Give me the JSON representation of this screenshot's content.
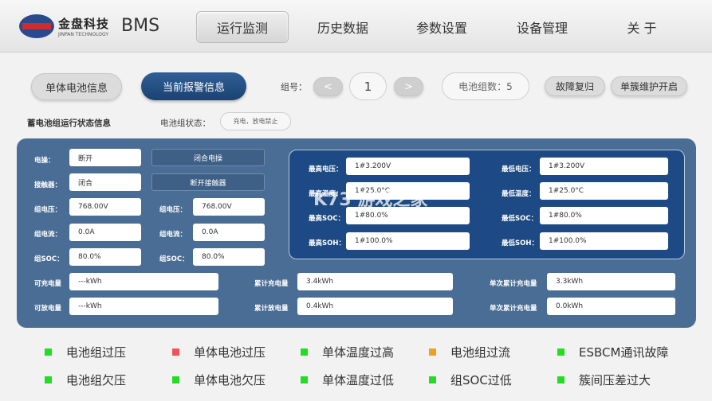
{
  "header": {
    "logo_cn": "金盘科技",
    "logo_en": "JINPAN TECHNOLOGY",
    "app_title": "BMS",
    "nav": [
      "运行监测",
      "历史数据",
      "参数设置",
      "设备管理",
      "关 于"
    ]
  },
  "toolbar": {
    "tab_cell": "单体电池信息",
    "tab_alarm": "当前报警信息",
    "group_label": "组号：",
    "prev": "<",
    "group_no": "1",
    "next": ">",
    "group_count": "电池组数：5",
    "fault_reset": "故障复归",
    "maint_on": "单簇维护开启"
  },
  "status": {
    "section_title": "蓄电池组运行状态信息",
    "state_label": "电池组状态：",
    "state_value": "充电，放电禁止"
  },
  "left": {
    "power_label": "电操：",
    "power_value": "断开",
    "close_btn": "闭合电操",
    "contactor_label": "接触器：",
    "contactor_value": "闭合",
    "open_contactor_btn": "断开接触器",
    "v1_label": "组电压：",
    "v1": "768.00V",
    "v2_label": "组电压：",
    "v2": "768.00V",
    "i1_label": "组电流：",
    "i1": "0.0A",
    "i2_label": "组电流：",
    "i2": "0.0A",
    "soc1_label": "组SOC：",
    "soc1": "80.0%",
    "soc2_label": "组SOC：",
    "soc2": "80.0%"
  },
  "extremes": {
    "max_v_label": "最高电压：",
    "max_v": "1#3.200V",
    "min_v_label": "最低电压：",
    "min_v": "1#3.200V",
    "max_t_label": "最高温度：",
    "max_t": "1#25.0°C",
    "min_t_label": "最低温度：",
    "min_t": "1#25.0°C",
    "max_soc_label": "最高SOC：",
    "max_soc": "1#80.0%",
    "min_soc_label": "最低SOC：",
    "min_soc": "1#80.0%",
    "max_soh_label": "最高SOH：",
    "max_soh": "1#100.0%",
    "min_soh_label": "最低SOH：",
    "min_soh": "1#100.0%"
  },
  "energy": {
    "chargeable_label": "可充电量",
    "chargeable": "---kWh",
    "dischargeable_label": "可放电量",
    "dischargeable": "---kWh",
    "cum_charge_label": "累计充电量",
    "cum_charge": "3.4kWh",
    "cum_discharge_label": "累计放电量",
    "cum_discharge": "0.4kWh",
    "single_charge_label": "单次累计充电量",
    "single_charge": "3.3kWh",
    "single_charge2_label": "单次累计充电量",
    "single_charge2": "0.0kWh"
  },
  "alarms": [
    {
      "label": "电池组过压",
      "color": "#22dd22"
    },
    {
      "label": "单体电池过压",
      "color": "#ee5555"
    },
    {
      "label": "单体温度过高",
      "color": "#22dd22"
    },
    {
      "label": "电池组过流",
      "color": "#f0a020"
    },
    {
      "label": "ESBCM通讯故障",
      "color": "#22dd22"
    },
    {
      "label": "电池组欠压",
      "color": "#22dd22"
    },
    {
      "label": "单体电池欠压",
      "color": "#22dd22"
    },
    {
      "label": "单体温度过低",
      "color": "#22dd22"
    },
    {
      "label": "组SOC过低",
      "color": "#22dd22"
    },
    {
      "label": "簇间压差过大",
      "color": "#22dd22"
    }
  ],
  "watermark": "K73 游戏之家"
}
